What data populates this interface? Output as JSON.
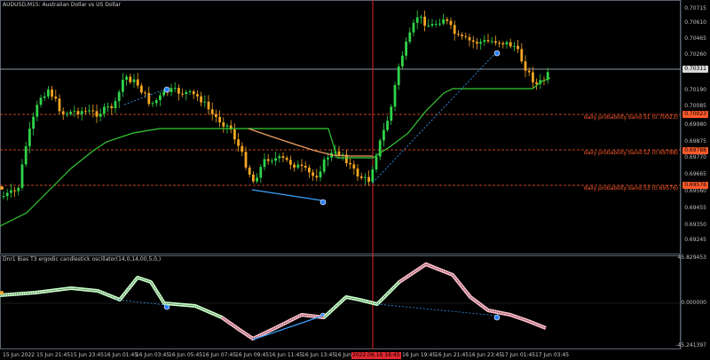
{
  "window": {
    "title": "AUDUSD,M15:  Australian Dollar vs US Dollar",
    "indicator_title": "Dnr1 Bias T3 ergodic candlestick oscillator(14,0,14,00,5,0,)"
  },
  "colors": {
    "bull": "#2fd34a",
    "bear": "#f5a623",
    "band_line": "#ff5a2a",
    "cursor": "#e0262d",
    "trend": "#3aa0ff",
    "ma_green": "#33cc33",
    "ma_orange": "#f0a060",
    "osc_up": "#c8ffc8",
    "osc_down": "#ffb8c8"
  },
  "price_axis": {
    "ticks": [
      "0.70715",
      "0.70610",
      "0.70465",
      "0.70260",
      "0.70190",
      "0.70085",
      "0.69980",
      "0.69875",
      "0.69770",
      "0.69665",
      "0.69560",
      "0.69455",
      "0.69350",
      "0.69245"
    ],
    "current": "0.70311",
    "s1_tag": "0.70023",
    "s2_tag": "0.69788",
    "s3_tag": "0.69576"
  },
  "bands": [
    {
      "label": "daily probability band S1 (0.70023)"
    },
    {
      "label": "daily probability band S2 (0.69788)"
    },
    {
      "label": "daily probability band S3 (0.69576)"
    }
  ],
  "osc_axis": {
    "top": "45.829453",
    "mid": "0.000000",
    "bottom": "-45.241397"
  },
  "time_axis": {
    "labels": [
      "15 Jun 2022",
      "15 Jun 21:45",
      "15 Jun 23:45",
      "16 Jun 01:45",
      "16 Jun 03:45",
      "16 Jun 05:45",
      "16 Jun 07:45",
      "16 Jun 09:45",
      "16 Jun 11:45",
      "16 Jun 13:45",
      "16 Jun 15:45",
      "16 Jun 19:45",
      "16 Jun 21:45",
      "16 Jun 23:45",
      "17 Jun 01:45",
      "17 Jun 03:45"
    ],
    "highlight": "2022.06.16 16:45"
  }
}
